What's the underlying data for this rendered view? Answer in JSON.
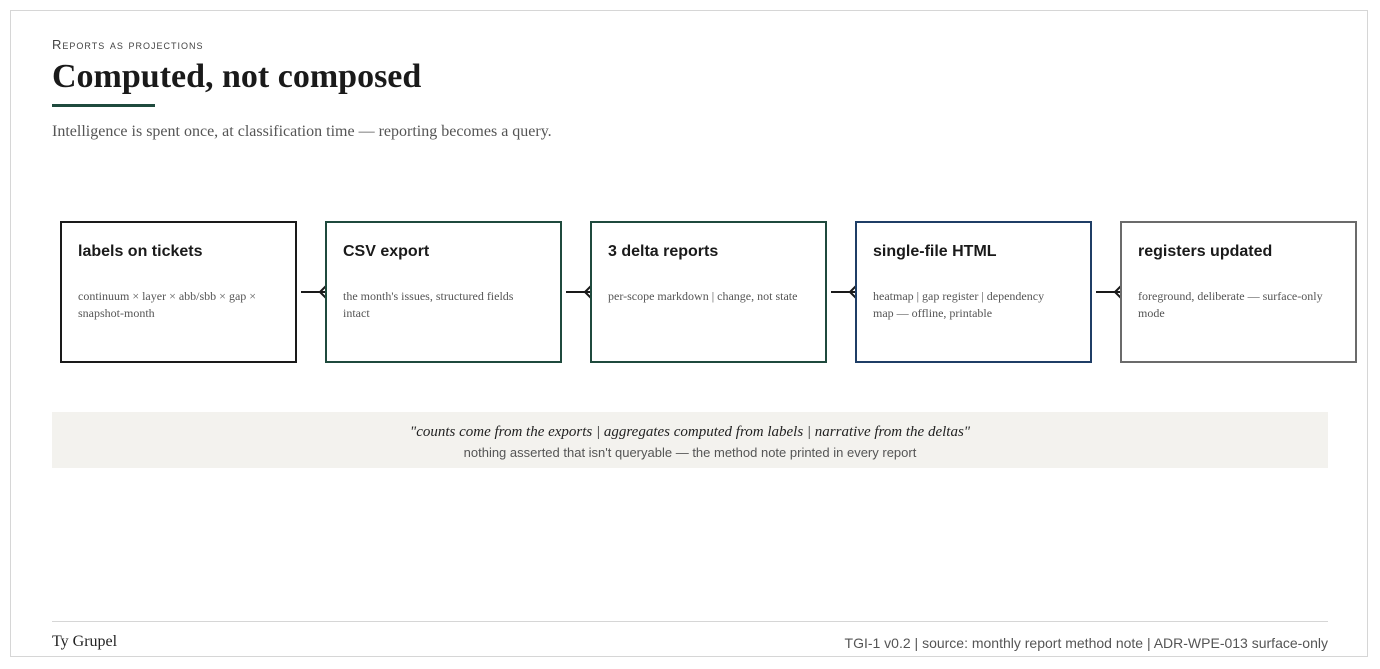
{
  "header": {
    "eyebrow": "Reports as projections",
    "title": "Computed, not composed",
    "subtitle": "Intelligence is spent once, at classification time — reporting becomes a query."
  },
  "steps": [
    {
      "title": "labels on tickets",
      "desc": "continuum × layer × abb/sbb × gap × snapshot-month",
      "border_color": "#1a1a1a"
    },
    {
      "title": "CSV export",
      "desc": "the month's issues, structured fields intact",
      "border_color": "#1f4a3d"
    },
    {
      "title": "3 delta reports",
      "desc": "per-scope markdown | change, not state",
      "border_color": "#1f4a3d"
    },
    {
      "title": "single-file HTML",
      "desc": "heatmap | gap register | dependency map — offline, printable",
      "border_color": "#1f3e66"
    },
    {
      "title": "registers updated",
      "desc": "foreground, deliberate — surface-only mode",
      "border_color": "#6b6b6b"
    }
  ],
  "callout": {
    "quote": "\"counts come from the exports | aggregates computed from labels | narrative from the deltas\"",
    "note": "nothing asserted that isn't queryable — the method note printed in every report"
  },
  "footer": {
    "author": "Ty Grupel",
    "meta": "TGI-1 v0.2 | source: monthly report method note | ADR-WPE-013 surface-only"
  }
}
